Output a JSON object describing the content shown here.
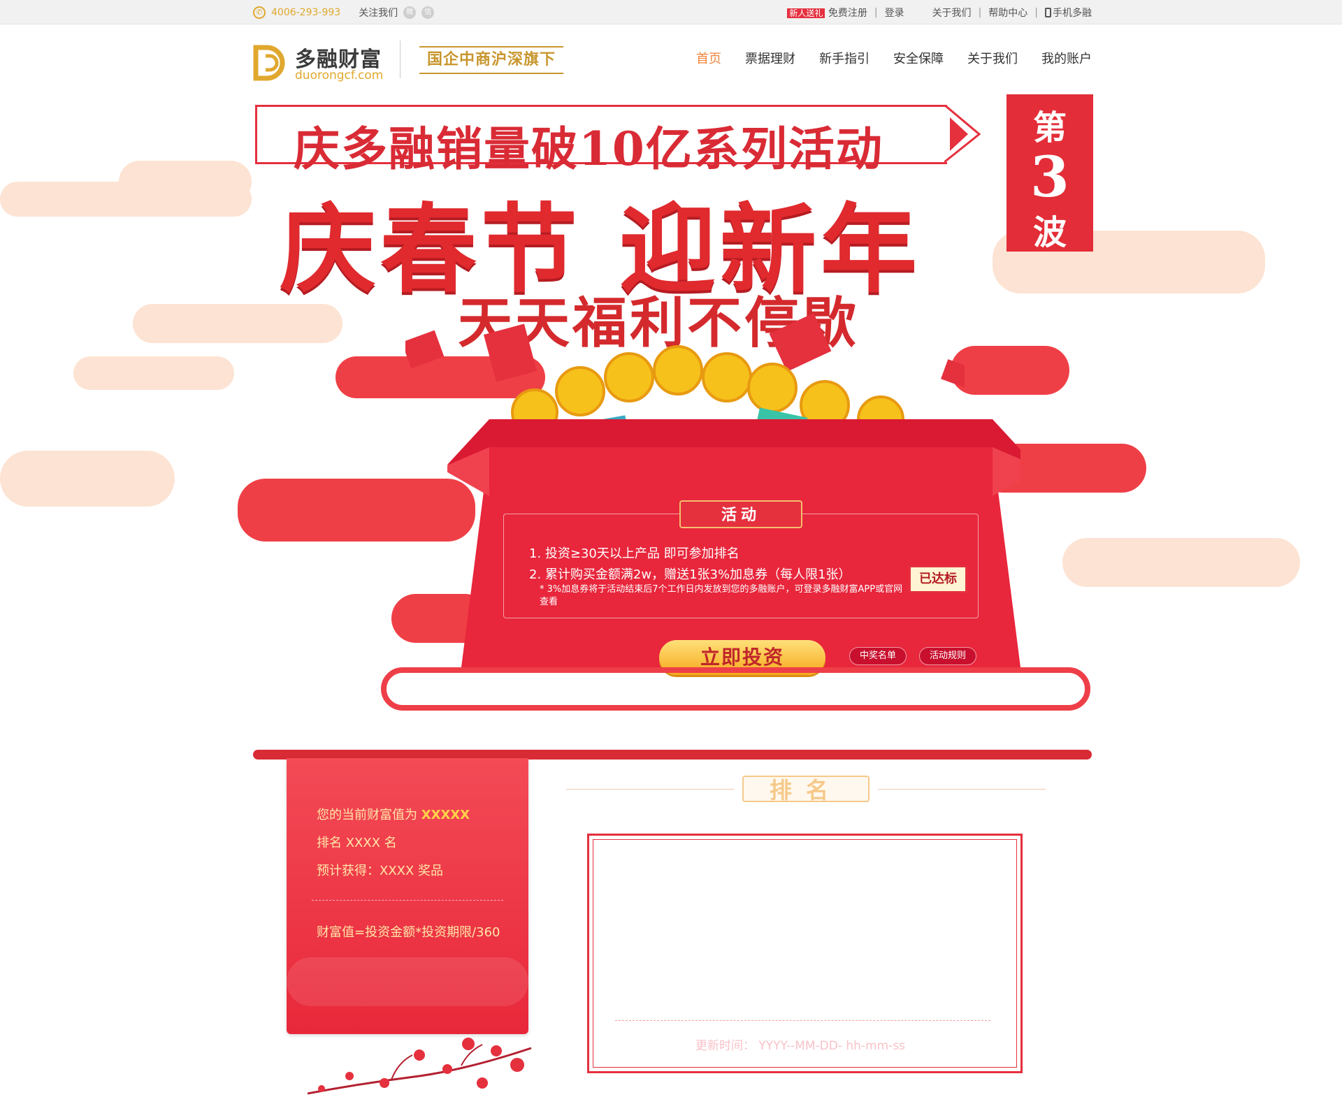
{
  "topbar": {
    "phone": "4006-293-993",
    "follow_label": "关注我们",
    "new_badge": "新人送礼",
    "register": "免费注册",
    "login": "登录",
    "about": "关于我们",
    "help": "帮助中心",
    "mobile": "手机多融"
  },
  "header": {
    "logo_name": "多融财富",
    "logo_domain": "duorongcf.com",
    "slogan": "国企中商沪深旗下",
    "nav": [
      "首页",
      "票据理财",
      "新手指引",
      "安全保障",
      "关于我们",
      "我的账户"
    ]
  },
  "banner": {
    "title_line1": "庆多融销量破10亿系列活动",
    "title_line2": "庆春节 迎新年",
    "title_line3": "天天福利不停歇",
    "wave_tag": [
      "第",
      "3",
      "波"
    ],
    "activity_title": "活动",
    "activity_items": [
      "1. 投资≥30天以上产品 即可参加排名",
      "2. 累计购买金额满2w，赠送1张3%加息券（每人限1张）"
    ],
    "activity_note": "* 3%加息券将于活动结束后7个工作日内发放到您的多融账户，可登录多融财富APP或官网查看",
    "reached_stamp": "已达标",
    "invest_button": "立即投资",
    "winners_button": "中奖名单",
    "rules_button": "活动规则"
  },
  "wealth": {
    "current_label": "您的当前财富值为",
    "current_value": "XXXXX",
    "rank_text": "排名 XXXX 名",
    "prize_text": "预计获得：XXXX 奖品",
    "formula": "财富值=投资金额*投资期限/360"
  },
  "ranking": {
    "heading": "排名",
    "update_text": "更新时间： YYYY--MM-DD- hh-mm-ss"
  },
  "colors": {
    "primary_red": "#e5303e",
    "accent_gold": "#e0a82e",
    "nav_active": "#f0843b"
  }
}
